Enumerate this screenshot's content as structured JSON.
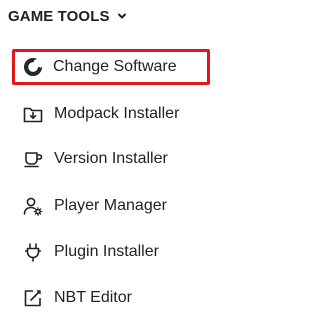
{
  "section": {
    "title": "GAME TOOLS",
    "chevron_icon": "chevron-down-icon"
  },
  "menu": {
    "items": [
      {
        "label": "Change Software",
        "icon": "change-software-icon",
        "selected": true
      },
      {
        "label": "Modpack Installer",
        "icon": "folder-download-icon",
        "selected": false
      },
      {
        "label": "Version Installer",
        "icon": "mug-icon",
        "selected": false
      },
      {
        "label": "Player Manager",
        "icon": "user-gear-icon",
        "selected": false
      },
      {
        "label": "Plugin Installer",
        "icon": "plug-icon",
        "selected": false
      },
      {
        "label": "NBT Editor",
        "icon": "edit-icon",
        "selected": false
      }
    ]
  },
  "colors": {
    "selected_outline": "#e5161b",
    "text": "#222222"
  }
}
